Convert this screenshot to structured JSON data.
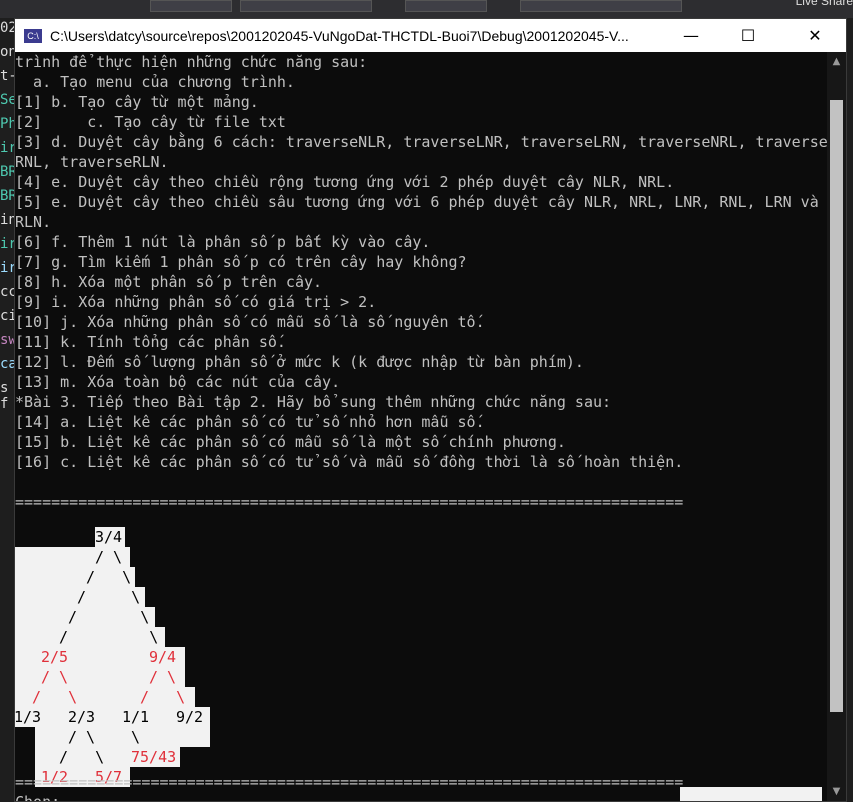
{
  "window": {
    "title": "C:\\Users\\datcy\\source\\repos\\2001202045-VuNgoDat-THCTDL-Buoi7\\Debug\\2001202045-V...",
    "icon_label": "C:\\",
    "minimize_glyph": "—",
    "maximize_glyph": "☐",
    "close_glyph": "✕"
  },
  "background_ide": {
    "live_share": "Live Share",
    "left_gutter": [
      "02",
      "on",
      "t-",
      "Se",
      "Ph",
      "ir",
      "BR",
      "BR",
      "in",
      "ir",
      "ir",
      "cc",
      "ci",
      "sw",
      "ca",
      "s f"
    ]
  },
  "console": {
    "lines": [
      "trình để thực hiện những chức năng sau:",
      "  a. Tạo menu của chương trình.",
      "[1] b. Tạo cây từ một mảng.",
      "[2]     c. Tạo cây từ file txt",
      "[3] d. Duyệt cây bằng 6 cách: traverseNLR, traverseLNR, traverseLRN, traverseNRL, traverse",
      "RNL, traverseRLN.",
      "[4] e. Duyệt cây theo chiều rộng tương ứng với 2 phép duyệt cây NLR, NRL.",
      "[5] e. Duyệt cây theo chiều sâu tương ứng với 6 phép duyệt cây NLR, NRL, LNR, RNL, LRN và",
      "RLN.",
      "[6] f. Thêm 1 nút là phân số p bất kỳ vào cây.",
      "[7] g. Tìm kiếm 1 phân số p có trên cây hay không?",
      "[8] h. Xóa một phân số p trên cây.",
      "[9] i. Xóa những phân số có giá trị > 2.",
      "[10] j. Xóa những phân số có mẫu số là số nguyên tố.",
      "[11] k. Tính tổng các phân số.",
      "[12] l. Đếm số lượng phân số ở mức k (k được nhập từ bàn phím).",
      "[13] m. Xóa toàn bộ các nút của cây.",
      "*Bài 3. Tiếp theo Bài tập 2. Hãy bổ sung thêm những chức năng sau:",
      "[14] a. Liệt kê các phân số có tử số nhỏ hơn mẫu số.",
      "[15] b. Liệt kê các phân số có mẫu số là một số chính phương.",
      "[16] c. Liệt kê các phân số có tử số và mẫu số đồng thời là số hoàn thiện."
    ],
    "separator": "==========================================================================",
    "separator_bottom": "==========================================================================",
    "prompt": "Chon: "
  },
  "tree": {
    "nodes": {
      "root": "3/4",
      "n25": "2/5",
      "n94": "9/4",
      "n13": "1/3",
      "n23": "2/3",
      "n11": "1/1",
      "n92": "9/2",
      "n12": "1/2",
      "n57": "5/7",
      "n7543": "75/43"
    },
    "colors": {
      "black": "#000000",
      "red": "#e0303a"
    }
  }
}
